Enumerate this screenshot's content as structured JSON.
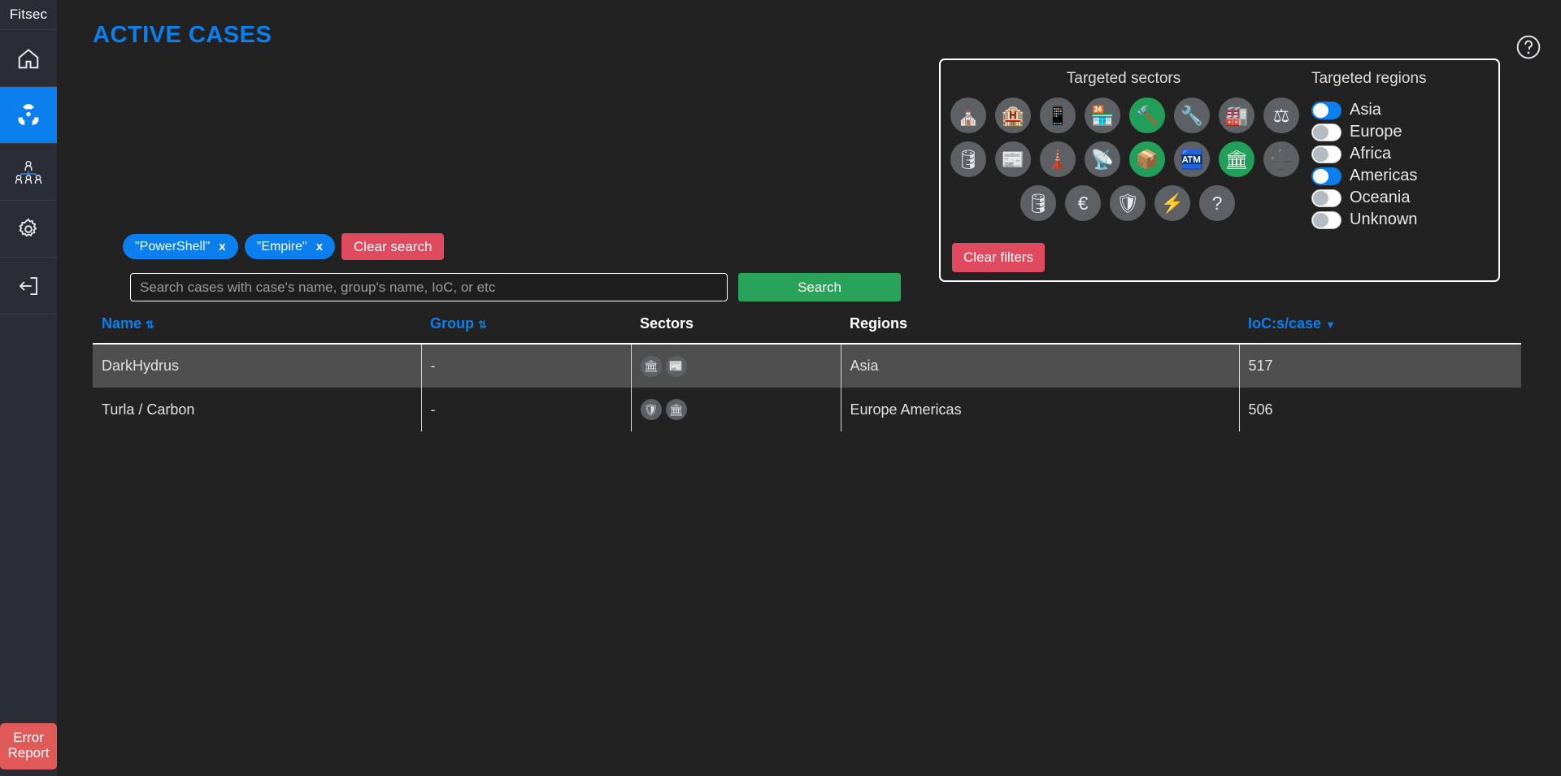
{
  "app": {
    "logo": "Fitsec"
  },
  "sidebar": {
    "items": [
      {
        "name": "home",
        "icon": "home-icon",
        "active": false
      },
      {
        "name": "cases",
        "icon": "radiation-icon",
        "active": true
      },
      {
        "name": "groups",
        "icon": "org-chart-icon",
        "active": false
      },
      {
        "name": "settings",
        "icon": "gear-icon",
        "active": false
      },
      {
        "name": "logout",
        "icon": "logout-icon",
        "active": false
      }
    ],
    "error_report": "Error\nReport",
    "error_report_line1": "Error",
    "error_report_line2": "Report"
  },
  "header": {
    "title": "ACTIVE CASES",
    "help": "?"
  },
  "filters": {
    "sectors_title": "Targeted sectors",
    "regions_title": "Targeted regions",
    "clear_filters_label": "Clear filters",
    "active_color": "#22a05a",
    "inactive_color": "#5d6166",
    "sectors": [
      {
        "name": "religious",
        "glyph": "⛪",
        "active": false
      },
      {
        "name": "hospitality",
        "glyph": "🏨",
        "active": false
      },
      {
        "name": "electronics",
        "glyph": "📱",
        "active": false
      },
      {
        "name": "retail",
        "glyph": "🏪",
        "active": false
      },
      {
        "name": "construction",
        "glyph": "🔨",
        "active": true
      },
      {
        "name": "engineering",
        "glyph": "🔧",
        "active": false
      },
      {
        "name": "manufacturing",
        "glyph": "🏭",
        "active": false
      },
      {
        "name": "legal",
        "glyph": "⚖",
        "active": false
      },
      {
        "name": "chemical-gas",
        "glyph": "🛢",
        "active": false
      },
      {
        "name": "media",
        "glyph": "📰",
        "active": false
      },
      {
        "name": "utilities",
        "glyph": "🗼",
        "active": false
      },
      {
        "name": "telecom",
        "glyph": "📡",
        "active": false
      },
      {
        "name": "logistics",
        "glyph": "📦",
        "active": true
      },
      {
        "name": "atm-banking",
        "glyph": "🏧",
        "active": false
      },
      {
        "name": "government",
        "glyph": "🏛",
        "active": true
      },
      {
        "name": "healthcare",
        "glyph": "➕",
        "active": false
      },
      {
        "name": "oil",
        "glyph": "🛢",
        "active": false
      },
      {
        "name": "finance",
        "glyph": "€",
        "active": false
      },
      {
        "name": "security",
        "glyph": "🛡",
        "active": false
      },
      {
        "name": "energy",
        "glyph": "⚡",
        "active": false
      },
      {
        "name": "unknown",
        "glyph": "?",
        "active": false
      }
    ],
    "regions": [
      {
        "label": "Asia",
        "on": true
      },
      {
        "label": "Europe",
        "on": false
      },
      {
        "label": "Africa",
        "on": false
      },
      {
        "label": "Americas",
        "on": true
      },
      {
        "label": "Oceania",
        "on": false
      },
      {
        "label": "Unknown",
        "on": false
      }
    ]
  },
  "search": {
    "tags": [
      {
        "label": "\"PowerShell\"",
        "remove": "x"
      },
      {
        "label": "\"Empire\"",
        "remove": "x"
      }
    ],
    "clear_search_label": "Clear search",
    "placeholder": "Search cases with case's name, group's name, IoC, or etc",
    "value": "",
    "search_button_label": "Search"
  },
  "table": {
    "columns": [
      {
        "label": "Name",
        "sortable": true,
        "sort_glyph": "⇅"
      },
      {
        "label": "Group",
        "sortable": true,
        "sort_glyph": "⇅"
      },
      {
        "label": "Sectors",
        "sortable": false,
        "sort_glyph": ""
      },
      {
        "label": "Regions",
        "sortable": false,
        "sort_glyph": ""
      },
      {
        "label": "IoC:s/case",
        "sortable": true,
        "sort_glyph": "▼"
      }
    ],
    "rows": [
      {
        "name": "DarkHydrus",
        "group": "-",
        "sectors": [
          {
            "name": "government",
            "glyph": "🏛"
          },
          {
            "name": "media",
            "glyph": "📰"
          }
        ],
        "regions": "Asia",
        "iocs": "517",
        "highlight": true
      },
      {
        "name": "Turla / Carbon",
        "group": "-",
        "sectors": [
          {
            "name": "security",
            "glyph": "🛡"
          },
          {
            "name": "government",
            "glyph": "🏛"
          }
        ],
        "regions": "Europe Americas",
        "iocs": "506",
        "highlight": false
      }
    ]
  }
}
